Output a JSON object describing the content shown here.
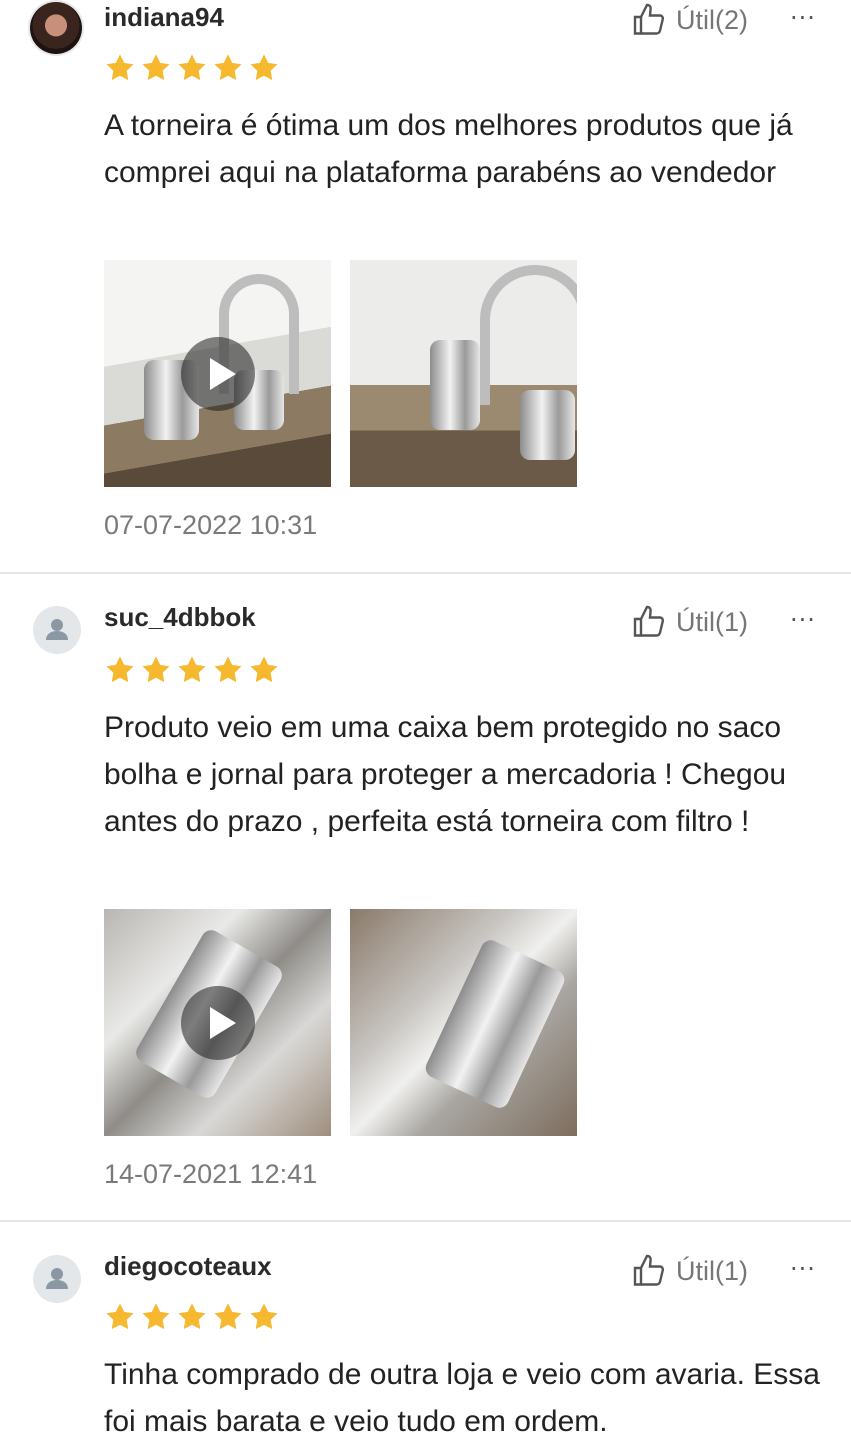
{
  "reviews": [
    {
      "username": "indiana94",
      "helpful_label": "Útil(2)",
      "more_label": "···",
      "rating": 5,
      "text": "A torneira é ótima um dos melhores produtos que já comprei aqui na plataforma parabéns ao vendedor",
      "date": "07-07-2022 10:31",
      "avatar": "photo"
    },
    {
      "username": "suc_4dbbok",
      "helpful_label": "Útil(1)",
      "more_label": "···",
      "rating": 5,
      "text": "Produto veio em uma caixa bem protegido no saco bolha e jornal para proteger a mercadoria ! Chegou antes do prazo , perfeita está torneira com filtro !",
      "date": "14-07-2021 12:41",
      "avatar": "default"
    },
    {
      "username": "diegocoteaux",
      "helpful_label": "Útil(1)",
      "more_label": "···",
      "rating": 5,
      "text": "Tinha comprado de outra loja e veio com avaria. Essa foi mais barata e veio tudo em ordem.",
      "avatar": "default"
    }
  ],
  "colors": {
    "star": "#f5b82e",
    "muted": "#767676",
    "divider": "#e6e6e6"
  },
  "icons": [
    "thumbs-up-icon",
    "more-icon",
    "star-icon",
    "play-icon",
    "user-icon"
  ]
}
